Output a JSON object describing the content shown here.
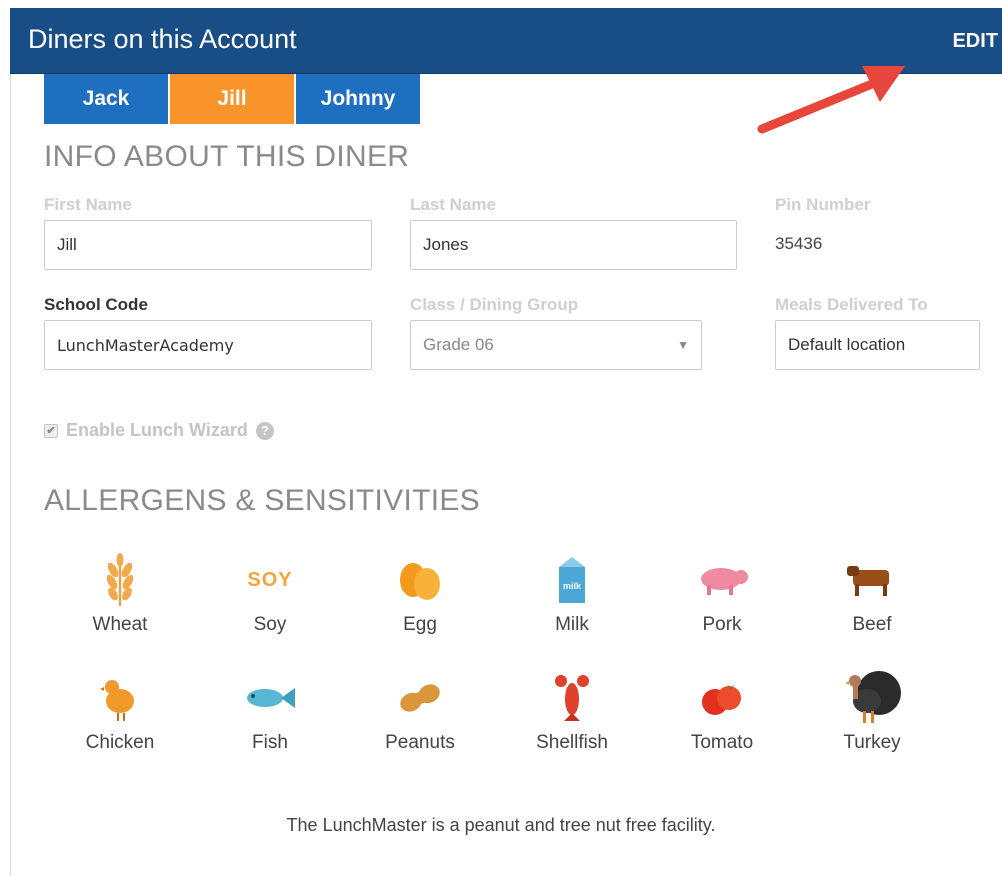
{
  "header": {
    "title": "Diners on this Account",
    "edit_label": "EDIT"
  },
  "tabs": [
    {
      "label": "Jack",
      "color": "#1f6fc1"
    },
    {
      "label": "Jill",
      "color": "#f7942a"
    },
    {
      "label": "Johnny",
      "color": "#1f6fc1"
    }
  ],
  "info": {
    "title": "INFO ABOUT THIS DINER",
    "first_name": {
      "label": "First Name",
      "value": "Jill"
    },
    "last_name": {
      "label": "Last Name",
      "value": "Jones"
    },
    "pin": {
      "label": "Pin Number",
      "value": "35436"
    },
    "school_code": {
      "label": "School Code",
      "value": "LunchMasterAcademy"
    },
    "class_group": {
      "label": "Class / Dining Group",
      "value": "Grade 06"
    },
    "meals_to": {
      "label": "Meals Delivered To",
      "value": "Default location"
    },
    "wizard_label": "Enable Lunch Wizard"
  },
  "allergens": {
    "title": "ALLERGENS & SENSITIVITIES",
    "items": [
      {
        "label": "Wheat",
        "icon": "wheat-icon"
      },
      {
        "label": "Soy",
        "icon": "soy-icon",
        "icon_text": "SOY"
      },
      {
        "label": "Egg",
        "icon": "egg-icon"
      },
      {
        "label": "Milk",
        "icon": "milk-icon",
        "icon_text": "milk"
      },
      {
        "label": "Pork",
        "icon": "pig-icon"
      },
      {
        "label": "Beef",
        "icon": "cow-icon"
      },
      {
        "label": "Chicken",
        "icon": "chicken-icon"
      },
      {
        "label": "Fish",
        "icon": "fish-icon"
      },
      {
        "label": "Peanuts",
        "icon": "peanut-icon"
      },
      {
        "label": "Shellfish",
        "icon": "lobster-icon"
      },
      {
        "label": "Tomato",
        "icon": "tomato-icon"
      },
      {
        "label": "Turkey",
        "icon": "turkey-icon"
      }
    ],
    "note": "The LunchMaster is a peanut and tree nut free facility."
  },
  "colors": {
    "header": "#184d86",
    "tab_blue": "#1f6fc1",
    "tab_active": "#f7942a",
    "arrow": "#e8453c"
  }
}
